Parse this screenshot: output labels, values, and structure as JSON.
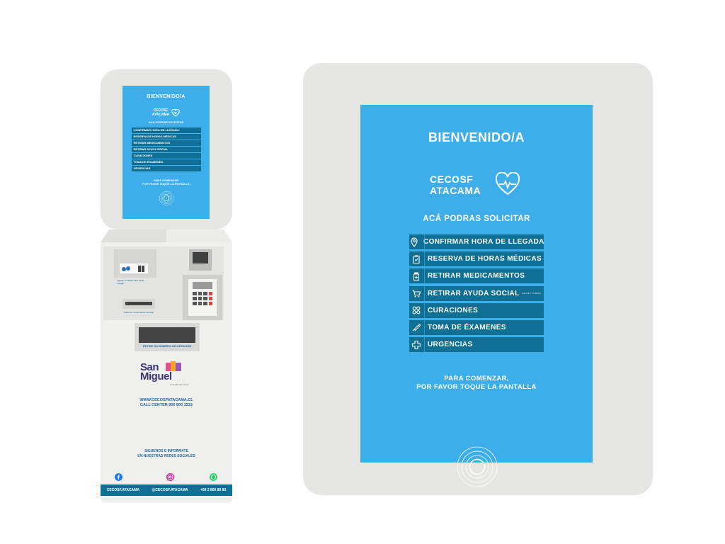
{
  "screen": {
    "welcome": "BIENVENIDO/A",
    "brand_line1": "CECOSF",
    "brand_line2": "ATACAMA",
    "subtitle": "ACÁ PODRAS SOLICITAR",
    "menu": [
      {
        "label": "CONFIRMAR HORA DE LLEGADA",
        "icon": "location-pin-icon"
      },
      {
        "label": "RESERVA DE HORAS MÉDICAS",
        "icon": "clipboard-icon"
      },
      {
        "label": "RETIRAR MEDICAMENTOS",
        "icon": "pill-bottle-icon"
      },
      {
        "label": "RETIRAR AYUDA SOCIAL",
        "icon": "cart-icon",
        "note": "(LECHE Y COMIDA)"
      },
      {
        "label": "CURACIONES",
        "icon": "bandage-icon"
      },
      {
        "label": "TOMA DE ÉXAMENES",
        "icon": "syringe-icon"
      },
      {
        "label": "URGENCIAS",
        "icon": "medical-cross-icon"
      }
    ],
    "begin_line1": "PARA COMENZAR,",
    "begin_line2": "POR FAVOR TOQUE LA PANTALLA"
  },
  "mini": {
    "begin_line1": "PARA COMENZAR",
    "begin_line2": "POR FAVOR TOQUE LA PANTALLA"
  },
  "kiosk": {
    "card_note": "Ingrese su tarjeta para retirar o pagar",
    "receipt_note": "Retire su comprobante de pago.",
    "ticket_label": "RETIRE SU NÚMERO DE ATENCIÓN",
    "logo_line1": "San",
    "logo_line2": "Miguel",
    "logo_sub": "TU ALIADO EN SALUD",
    "website": "WWW.CECOSFATACAMA.CL",
    "call_center": "CALL CENTER 800 800 3233",
    "follow_line1": "SIGUENOS E INFORMATE",
    "follow_line2": "EN NUESTRAS REDES SOCIALES",
    "social": [
      "CECOSF.ATACAMA",
      "@CECOSF.ATACAMA",
      "+56 2 800 80 83"
    ]
  },
  "colors": {
    "screen_bg": "#3daee9",
    "menu_bg": "#0f6f94",
    "frame": "#e6e6e4",
    "accent_text": "#1f6aa8"
  }
}
